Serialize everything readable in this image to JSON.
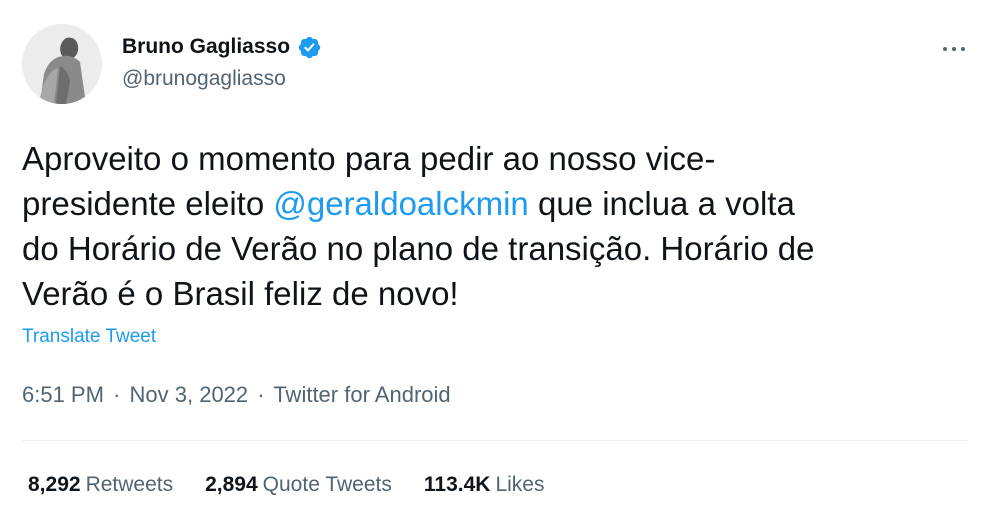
{
  "user": {
    "display_name": "Bruno Gagliasso",
    "handle": "@brunogagliasso",
    "verified": true,
    "avatar_icon": "profile-photo"
  },
  "tweet": {
    "lines": [
      [
        {
          "text": "Aproveito o momento para pedir ao nosso vice-",
          "mention": false
        }
      ],
      [
        {
          "text": "presidente eleito ",
          "mention": false
        },
        {
          "text": "@geraldoalckmin",
          "mention": true
        },
        {
          "text": " que inclua a volta",
          "mention": false
        }
      ],
      [
        {
          "text": "do Horário de Verão no plano de transição. Horário de",
          "mention": false
        }
      ],
      [
        {
          "text": "Verão é o Brasil feliz de novo!",
          "mention": false
        }
      ]
    ],
    "translate_label": "Translate Tweet"
  },
  "meta": {
    "time": "6:51 PM",
    "date": "Nov 3, 2022",
    "source": "Twitter for Android",
    "separator": "·"
  },
  "stats": [
    {
      "count": "8,292",
      "label": "Retweets"
    },
    {
      "count": "2,894",
      "label": "Quote Tweets"
    },
    {
      "count": "113.4K",
      "label": "Likes"
    }
  ],
  "colors": {
    "accent": "#1d9bf0",
    "secondary_text": "#536471",
    "primary_text": "#0f1419",
    "divider": "#eff3f4"
  },
  "icons": {
    "verified": "verified-badge-icon",
    "more": "more-options-icon"
  }
}
